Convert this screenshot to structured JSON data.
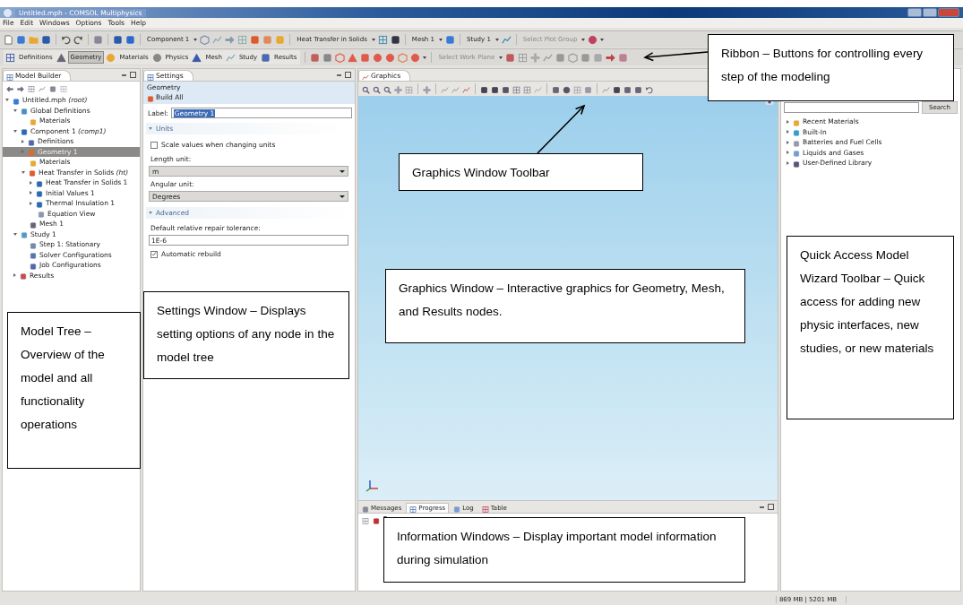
{
  "window": {
    "title": "Untitled.mph - COMSOL Multiphysics"
  },
  "menu": [
    "File",
    "Edit",
    "Windows",
    "Options",
    "Tools",
    "Help"
  ],
  "ribbon": {
    "main_toolbar": [
      {
        "label": "Component 1",
        "disabled": false
      },
      {
        "label": "Heat Transfer in Solids",
        "disabled": false
      },
      {
        "label": "Mesh 1",
        "disabled": false
      },
      {
        "label": "Study 1",
        "disabled": false
      },
      {
        "label": "Select Plot Group",
        "disabled": true
      }
    ],
    "tabs": [
      {
        "label": "Definitions",
        "selected": false
      },
      {
        "label": "Geometry",
        "selected": true
      },
      {
        "label": "Materials",
        "selected": false
      },
      {
        "label": "Physics",
        "selected": false
      },
      {
        "label": "Mesh",
        "selected": false
      },
      {
        "label": "Study",
        "selected": false
      },
      {
        "label": "Results",
        "selected": false
      }
    ],
    "work_plane": {
      "label": "Select Work Plane",
      "disabled": true
    }
  },
  "model_builder": {
    "title": "Model Builder",
    "tree": [
      {
        "label": "Untitled.mph *(root)*",
        "kind": "branch",
        "expanded": true,
        "selected": false,
        "children": [
          {
            "label": "Global Definitions",
            "kind": "branch",
            "expanded": true,
            "selected": false,
            "children": [
              {
                "label": "Materials",
                "kind": "leaf",
                "selected": false
              }
            ]
          },
          {
            "label": "Component 1 *(comp1)*",
            "kind": "branch",
            "expanded": true,
            "selected": false,
            "children": [
              {
                "label": "Definitions",
                "kind": "branch",
                "expanded": false,
                "selected": false
              },
              {
                "label": "Geometry 1",
                "kind": "branch",
                "expanded": false,
                "selected": true
              },
              {
                "label": "Materials",
                "kind": "leaf",
                "selected": false
              },
              {
                "label": "Heat Transfer in Solids *(ht)*",
                "kind": "branch",
                "expanded": true,
                "selected": false,
                "children": [
                  {
                    "label": "Heat Transfer in Solids 1",
                    "kind": "branch",
                    "expanded": false,
                    "selected": false
                  },
                  {
                    "label": "Initial Values 1",
                    "kind": "branch",
                    "expanded": false,
                    "selected": false
                  },
                  {
                    "label": "Thermal Insulation 1",
                    "kind": "branch",
                    "expanded": false,
                    "selected": false
                  },
                  {
                    "label": "Equation View",
                    "kind": "leaf",
                    "selected": false
                  }
                ]
              },
              {
                "label": "Mesh 1",
                "kind": "leaf",
                "selected": false
              }
            ]
          },
          {
            "label": "Study 1",
            "kind": "branch",
            "expanded": true,
            "selected": false,
            "children": [
              {
                "label": "Step 1: Stationary",
                "kind": "leaf",
                "selected": false
              },
              {
                "label": "Solver Configurations",
                "kind": "leaf",
                "selected": false
              },
              {
                "label": "Job Configurations",
                "kind": "leaf",
                "selected": false
              }
            ]
          },
          {
            "label": "Results",
            "kind": "branch",
            "expanded": false,
            "selected": false
          }
        ]
      }
    ]
  },
  "settings": {
    "title": "Settings",
    "node": "Geometry",
    "build_button": "Build All",
    "label_field": {
      "label": "Label:",
      "value": "Geometry 1"
    },
    "sections": [
      {
        "title": "Units",
        "expanded": true,
        "items": [
          {
            "kind": "checkbox",
            "label": "Scale values when changing units",
            "checked": false
          },
          {
            "kind": "select",
            "label": "Length unit:",
            "value": "m"
          },
          {
            "kind": "select",
            "label": "Angular unit:",
            "value": "Degrees"
          }
        ]
      },
      {
        "title": "Advanced",
        "expanded": true,
        "items": [
          {
            "kind": "text",
            "label": "Default relative repair tolerance:",
            "value": "1E-6"
          },
          {
            "kind": "checkbox",
            "label": "Automatic rebuild",
            "checked": true
          }
        ]
      }
    ]
  },
  "graphics": {
    "title": "Graphics"
  },
  "materials": {
    "search_button": "Search",
    "items": [
      {
        "label": "Recent Materials",
        "expanded": false
      },
      {
        "label": "Built-In",
        "expanded": false
      },
      {
        "label": "Batteries and Fuel Cells",
        "expanded": false
      },
      {
        "label": "Liquids and Gases",
        "expanded": false
      },
      {
        "label": "User-Defined Library",
        "expanded": false
      }
    ]
  },
  "info": {
    "tabs": [
      {
        "label": "Messages",
        "selected": false
      },
      {
        "label": "Progress",
        "selected": true
      },
      {
        "label": "Log",
        "selected": false
      },
      {
        "label": "Table",
        "selected": false
      }
    ]
  },
  "status_bar": {
    "memory": "869 MB | 5201 MB"
  },
  "annotations": [
    {
      "text": "Ribbon – Buttons for controlling every step of the modeling"
    },
    {
      "text": "Graphics Window Toolbar"
    },
    {
      "text": "Graphics Window – Interactive graphics for Geometry, Mesh, and Results nodes."
    },
    {
      "text": "Quick Access Model Wizard Toolbar – Quick access for adding new physic interfaces, new studies, or new materials"
    },
    {
      "text": "Model Tree – Overview of the model and all functionality operations"
    },
    {
      "text": "Settings Window – Displays setting options of any node in the model tree"
    },
    {
      "text": "Information Windows – Display important model information during simulation"
    }
  ]
}
